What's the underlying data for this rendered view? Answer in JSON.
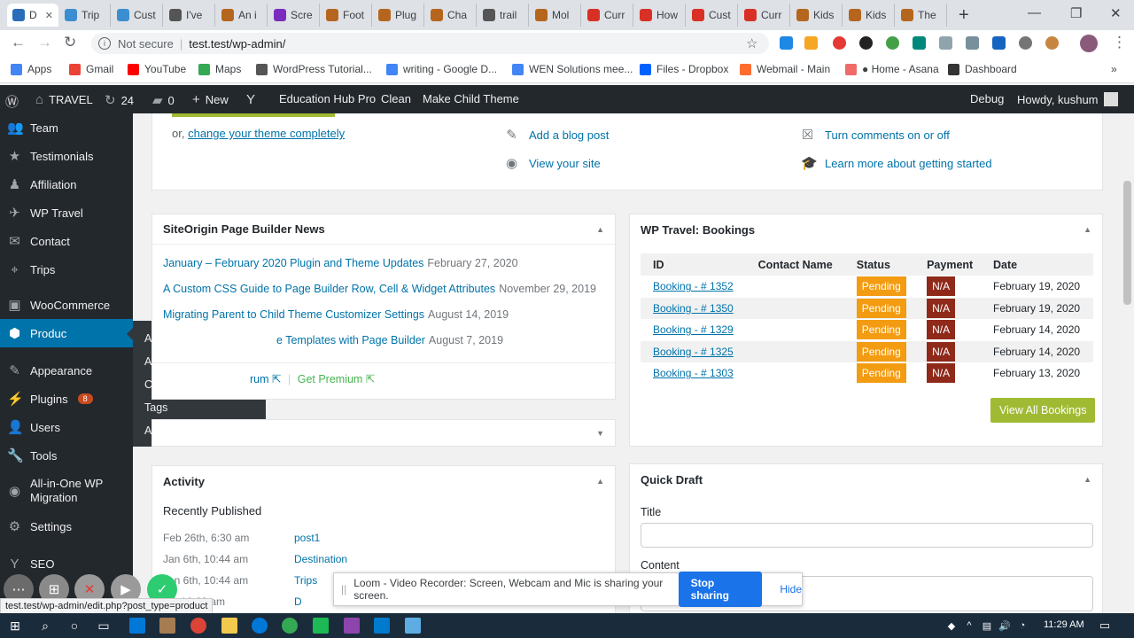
{
  "browser": {
    "tabs": [
      {
        "title": "D",
        "favicon_color": "#2a6ebb",
        "active": true
      },
      {
        "title": "Trip",
        "favicon_color": "#3b8ed0"
      },
      {
        "title": "Cust",
        "favicon_color": "#3b8ed0"
      },
      {
        "title": "I've",
        "favicon_color": "#555555"
      },
      {
        "title": "An i",
        "favicon_color": "#b5651d"
      },
      {
        "title": "Scre",
        "favicon_color": "#7b2cbf"
      },
      {
        "title": "Foot",
        "favicon_color": "#b5651d"
      },
      {
        "title": "Plug",
        "favicon_color": "#b5651d"
      },
      {
        "title": "Cha",
        "favicon_color": "#b5651d"
      },
      {
        "title": "trail",
        "favicon_color": "#555555"
      },
      {
        "title": "Mol",
        "favicon_color": "#b5651d"
      },
      {
        "title": "Curr",
        "favicon_color": "#d93025"
      },
      {
        "title": "How",
        "favicon_color": "#d93025"
      },
      {
        "title": "Cust",
        "favicon_color": "#d93025"
      },
      {
        "title": "Curr",
        "favicon_color": "#d93025"
      },
      {
        "title": "Kids",
        "favicon_color": "#b5651d"
      },
      {
        "title": "Kids",
        "favicon_color": "#b5651d"
      },
      {
        "title": "The",
        "favicon_color": "#b5651d"
      }
    ],
    "address": {
      "security": "Not secure",
      "url": "test.test/wp-admin/"
    },
    "bookmarks": [
      {
        "label": "Apps",
        "color": "#4285f4"
      },
      {
        "label": "Gmail",
        "color": "#ea4335"
      },
      {
        "label": "YouTube",
        "color": "#ff0000"
      },
      {
        "label": "Maps",
        "color": "#34a853"
      },
      {
        "label": "WordPress Tutorial...",
        "color": "#555555"
      },
      {
        "label": "writing - Google D...",
        "color": "#4285f4"
      },
      {
        "label": "WEN Solutions mee...",
        "color": "#4285f4"
      },
      {
        "label": "Files - Dropbox",
        "color": "#0061ff"
      },
      {
        "label": "Webmail - Main",
        "color": "#ff6c2c"
      },
      {
        "label": "● Home - Asana",
        "color": "#f06a6a"
      },
      {
        "label": "Dashboard",
        "color": "#333333"
      }
    ]
  },
  "adminbar": {
    "site": "TRAVEL",
    "updates": "24",
    "comments": "0",
    "new": "New",
    "items": [
      "Education Hub Pro",
      "Clean",
      "Make Child Theme"
    ],
    "debug": "Debug",
    "howdy": "Howdy, kushum"
  },
  "sidebar": {
    "items": [
      {
        "label": "Team",
        "icon": "team-icon",
        "glyph": "👥"
      },
      {
        "label": "Testimonials",
        "icon": "star-icon",
        "glyph": "★"
      },
      {
        "label": "Affiliation",
        "icon": "affiliation-icon",
        "glyph": "♟"
      },
      {
        "label": "WP Travel",
        "icon": "wp-travel-icon",
        "glyph": "✈"
      },
      {
        "label": "Contact",
        "icon": "envelope-icon",
        "glyph": "✉"
      },
      {
        "label": "Trips",
        "icon": "location-pin-icon",
        "glyph": "⌖"
      },
      {
        "label": "WooCommerce",
        "icon": "woocommerce-icon",
        "glyph": "▣"
      },
      {
        "label": "Produc",
        "icon": "products-icon",
        "glyph": "⬢"
      },
      {
        "label": "Appearance",
        "icon": "paintbrush-icon",
        "glyph": "✎"
      },
      {
        "label": "Plugins",
        "icon": "plugin-icon",
        "glyph": "⚡",
        "badge": "8"
      },
      {
        "label": "Users",
        "icon": "users-icon",
        "glyph": "👤"
      },
      {
        "label": "Tools",
        "icon": "wrench-icon",
        "glyph": "🔧"
      },
      {
        "label": "All-in-One WP Migration",
        "icon": "migration-icon",
        "glyph": "◉"
      },
      {
        "label": "Settings",
        "icon": "settings-icon",
        "glyph": "⚙"
      },
      {
        "label": "SEO",
        "icon": "yoast-icon",
        "glyph": "Y"
      }
    ],
    "flyout": [
      "All Products",
      "Add New",
      "Categories",
      "Tags",
      "Attributes"
    ]
  },
  "welcome": {
    "or_text": "or,",
    "change_theme": "change your theme completely",
    "actions_mid": [
      "Add a blog post",
      "View your site"
    ],
    "actions_right": [
      "Turn comments on or off",
      "Learn more about getting started"
    ]
  },
  "news": {
    "title": "SiteOrigin Page Builder News",
    "items": [
      {
        "title": "January – February 2020 Plugin and Theme Updates",
        "date": "February 27, 2020"
      },
      {
        "title": "A Custom CSS Guide to Page Builder Row, Cell & Widget Attributes",
        "date": "November 29, 2019"
      },
      {
        "title": "Migrating Parent to Child Theme Customizer Settings",
        "date": "August 14, 2019"
      },
      {
        "title": "e Templates with Page Builder",
        "date": "August 7, 2019"
      }
    ],
    "footer": {
      "forum": "rum",
      "premium": "Get Premium"
    }
  },
  "bookings": {
    "title": "WP Travel: Bookings",
    "headers": [
      "ID",
      "Contact Name",
      "Status",
      "Payment",
      "Date"
    ],
    "rows": [
      {
        "id": "Booking - # 1352",
        "contact": "",
        "status": "Pending",
        "payment": "N/A",
        "date": "February 19, 2020"
      },
      {
        "id": "Booking - # 1350",
        "contact": "",
        "status": "Pending",
        "payment": "N/A",
        "date": "February 19, 2020"
      },
      {
        "id": "Booking - # 1329",
        "contact": "",
        "status": "Pending",
        "payment": "N/A",
        "date": "February 14, 2020"
      },
      {
        "id": "Booking - # 1325",
        "contact": "",
        "status": "Pending",
        "payment": "N/A",
        "date": "February 14, 2020"
      },
      {
        "id": "Booking - # 1303",
        "contact": "",
        "status": "Pending",
        "payment": "N/A",
        "date": "February 13, 2020"
      }
    ],
    "view_all": "View All Bookings"
  },
  "activity": {
    "title": "Activity",
    "subtitle": "Recently Published",
    "items": [
      {
        "date": "Feb 26th, 6:30 am",
        "title": "post1"
      },
      {
        "date": "Jan 6th, 10:44 am",
        "title": "Destination"
      },
      {
        "date": "Jan 6th, 10:44 am",
        "title": "Trips"
      },
      {
        "date": "19, 10:23 am",
        "title": "D"
      }
    ]
  },
  "quickdraft": {
    "title": "Quick Draft",
    "title_label": "Title",
    "content_label": "Content"
  },
  "loom": {
    "message": "Loom - Video Recorder: Screen, Webcam and Mic is sharing your screen.",
    "stop": "Stop sharing",
    "hide": "Hide"
  },
  "statusbar": {
    "url": "test.test/wp-admin/edit.php?post_type=product"
  },
  "taskbar": {
    "time": "11:29 AM"
  }
}
